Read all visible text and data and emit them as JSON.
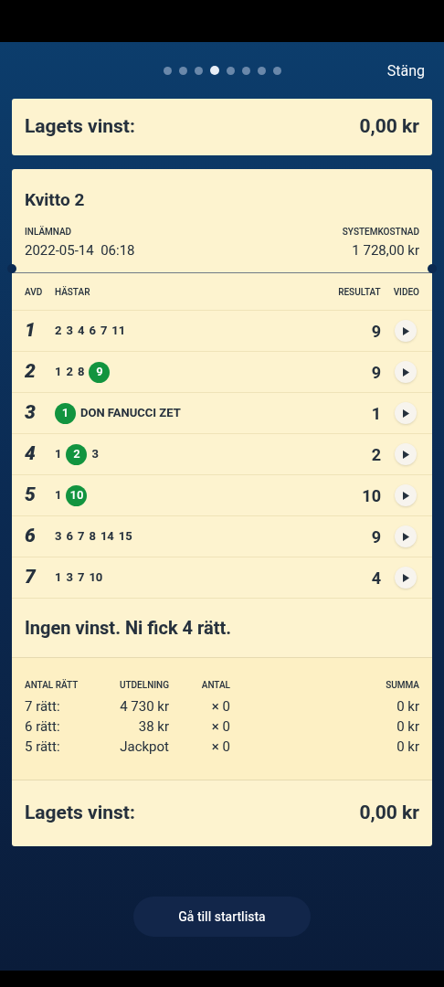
{
  "pager": {
    "dots": [
      {
        "selected": false
      },
      {
        "selected": false
      },
      {
        "selected": false
      },
      {
        "selected": true
      },
      {
        "selected": false
      },
      {
        "selected": false
      },
      {
        "selected": false
      },
      {
        "selected": false
      }
    ]
  },
  "close_label": "Stäng",
  "team_win_top": {
    "label": "Lagets vinst:",
    "value": "0,00 kr"
  },
  "receipt": {
    "title": "Kvitto 2",
    "submitted_label": "INLÄMNAD",
    "submitted_value": "2022-05-14  06:18",
    "cost_label": "SYSTEMKOSTNAD",
    "cost_value": "1 728,00 kr",
    "columns": [
      "AVD",
      "HÄSTAR",
      "RESULTAT",
      "VIDEO"
    ],
    "legs": [
      {
        "leg": "1",
        "horses": [
          {
            "number": "2",
            "winner": false
          },
          {
            "number": "3",
            "winner": false
          },
          {
            "number": "4",
            "winner": false
          },
          {
            "number": "6",
            "winner": false
          },
          {
            "number": "7",
            "winner": false
          },
          {
            "number": "11",
            "winner": false
          }
        ],
        "result": "9"
      },
      {
        "leg": "2",
        "horses": [
          {
            "number": "1",
            "winner": false
          },
          {
            "number": "2",
            "winner": false
          },
          {
            "number": "8",
            "winner": false
          },
          {
            "number": "9",
            "winner": true
          }
        ],
        "result": "9"
      },
      {
        "leg": "3",
        "horses": [
          {
            "number": "1",
            "winner": true,
            "name": "DON FANUCCI ZET"
          }
        ],
        "result": "1"
      },
      {
        "leg": "4",
        "horses": [
          {
            "number": "1",
            "winner": false
          },
          {
            "number": "2",
            "winner": true
          },
          {
            "number": "3",
            "winner": false
          }
        ],
        "result": "2"
      },
      {
        "leg": "5",
        "horses": [
          {
            "number": "1",
            "winner": false
          },
          {
            "number": "10",
            "winner": true
          }
        ],
        "result": "10"
      },
      {
        "leg": "6",
        "horses": [
          {
            "number": "3",
            "winner": false
          },
          {
            "number": "6",
            "winner": false
          },
          {
            "number": "7",
            "winner": false
          },
          {
            "number": "8",
            "winner": false
          },
          {
            "number": "14",
            "winner": false
          },
          {
            "number": "15",
            "winner": false
          }
        ],
        "result": "9"
      },
      {
        "leg": "7",
        "horses": [
          {
            "number": "1",
            "winner": false
          },
          {
            "number": "3",
            "winner": false
          },
          {
            "number": "7",
            "winner": false
          },
          {
            "number": "10",
            "winner": false
          }
        ],
        "result": "4"
      }
    ],
    "outcome": "Ingen vinst. Ni fick 4 rätt.",
    "payout": {
      "columns": [
        "ANTAL RÄTT",
        "UTDELNING",
        "ANTAL",
        "SUMMA"
      ],
      "rows": [
        [
          "7 rätt:",
          "4 730 kr",
          "× 0",
          "0 kr"
        ],
        [
          "6 rätt:",
          "38 kr",
          "× 0",
          "0 kr"
        ],
        [
          "5 rätt:",
          "Jackpot",
          "× 0",
          "0 kr"
        ]
      ]
    },
    "team_win": {
      "label": "Lagets vinst:",
      "value": "0,00 kr"
    }
  },
  "start_list_button": "Gå till startlista"
}
